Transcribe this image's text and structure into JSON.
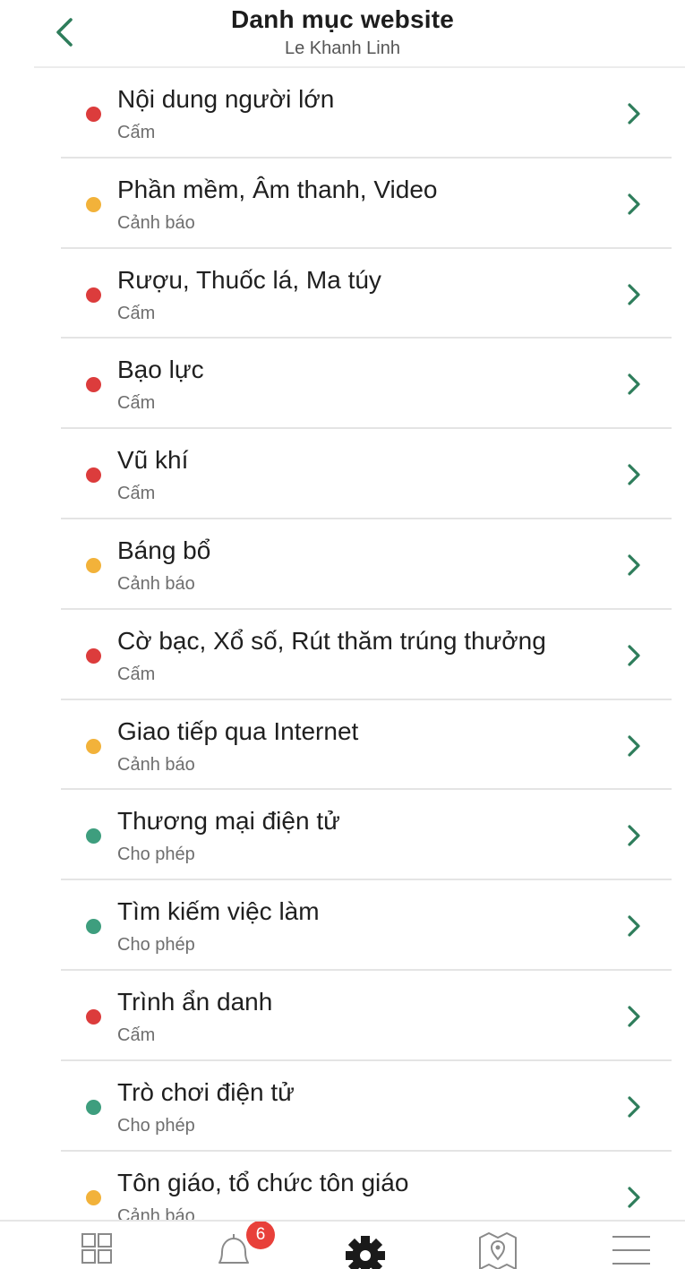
{
  "header": {
    "title": "Danh mục website",
    "subtitle": "Le Khanh Linh",
    "back_icon": "chevron-left-icon"
  },
  "colors": {
    "accent": "#2e7d5b",
    "blocked": "#dc3c3c",
    "warning": "#f2b23a",
    "allowed": "#3e9e7e"
  },
  "categories": [
    {
      "title": "Nội dung người lớn",
      "status": "Cấm",
      "level": "blocked"
    },
    {
      "title": "Phần mềm, Âm thanh, Video",
      "status": "Cảnh báo",
      "level": "warning"
    },
    {
      "title": "Rượu, Thuốc lá, Ma túy",
      "status": "Cấm",
      "level": "blocked"
    },
    {
      "title": "Bạo lực",
      "status": "Cấm",
      "level": "blocked"
    },
    {
      "title": "Vũ khí",
      "status": "Cấm",
      "level": "blocked"
    },
    {
      "title": "Báng bổ",
      "status": "Cảnh báo",
      "level": "warning"
    },
    {
      "title": "Cờ bạc, Xổ số, Rút thăm trúng thưởng",
      "status": "Cấm",
      "level": "blocked"
    },
    {
      "title": "Giao tiếp qua Internet",
      "status": "Cảnh báo",
      "level": "warning"
    },
    {
      "title": "Thương mại điện tử",
      "status": "Cho phép",
      "level": "allowed"
    },
    {
      "title": "Tìm kiếm việc làm",
      "status": "Cho phép",
      "level": "allowed"
    },
    {
      "title": "Trình ẩn danh",
      "status": "Cấm",
      "level": "blocked"
    },
    {
      "title": "Trò chơi điện tử",
      "status": "Cho phép",
      "level": "allowed"
    },
    {
      "title": "Tôn giáo, tổ chức tôn giáo",
      "status": "Cảnh báo",
      "level": "warning"
    }
  ],
  "tabbar": {
    "tabs": [
      {
        "icon": "dashboard-icon"
      },
      {
        "icon": "bell-icon"
      },
      {
        "icon": "gear-icon"
      },
      {
        "icon": "map-pin-icon"
      },
      {
        "icon": "menu-icon"
      }
    ],
    "notification_count": "6"
  }
}
